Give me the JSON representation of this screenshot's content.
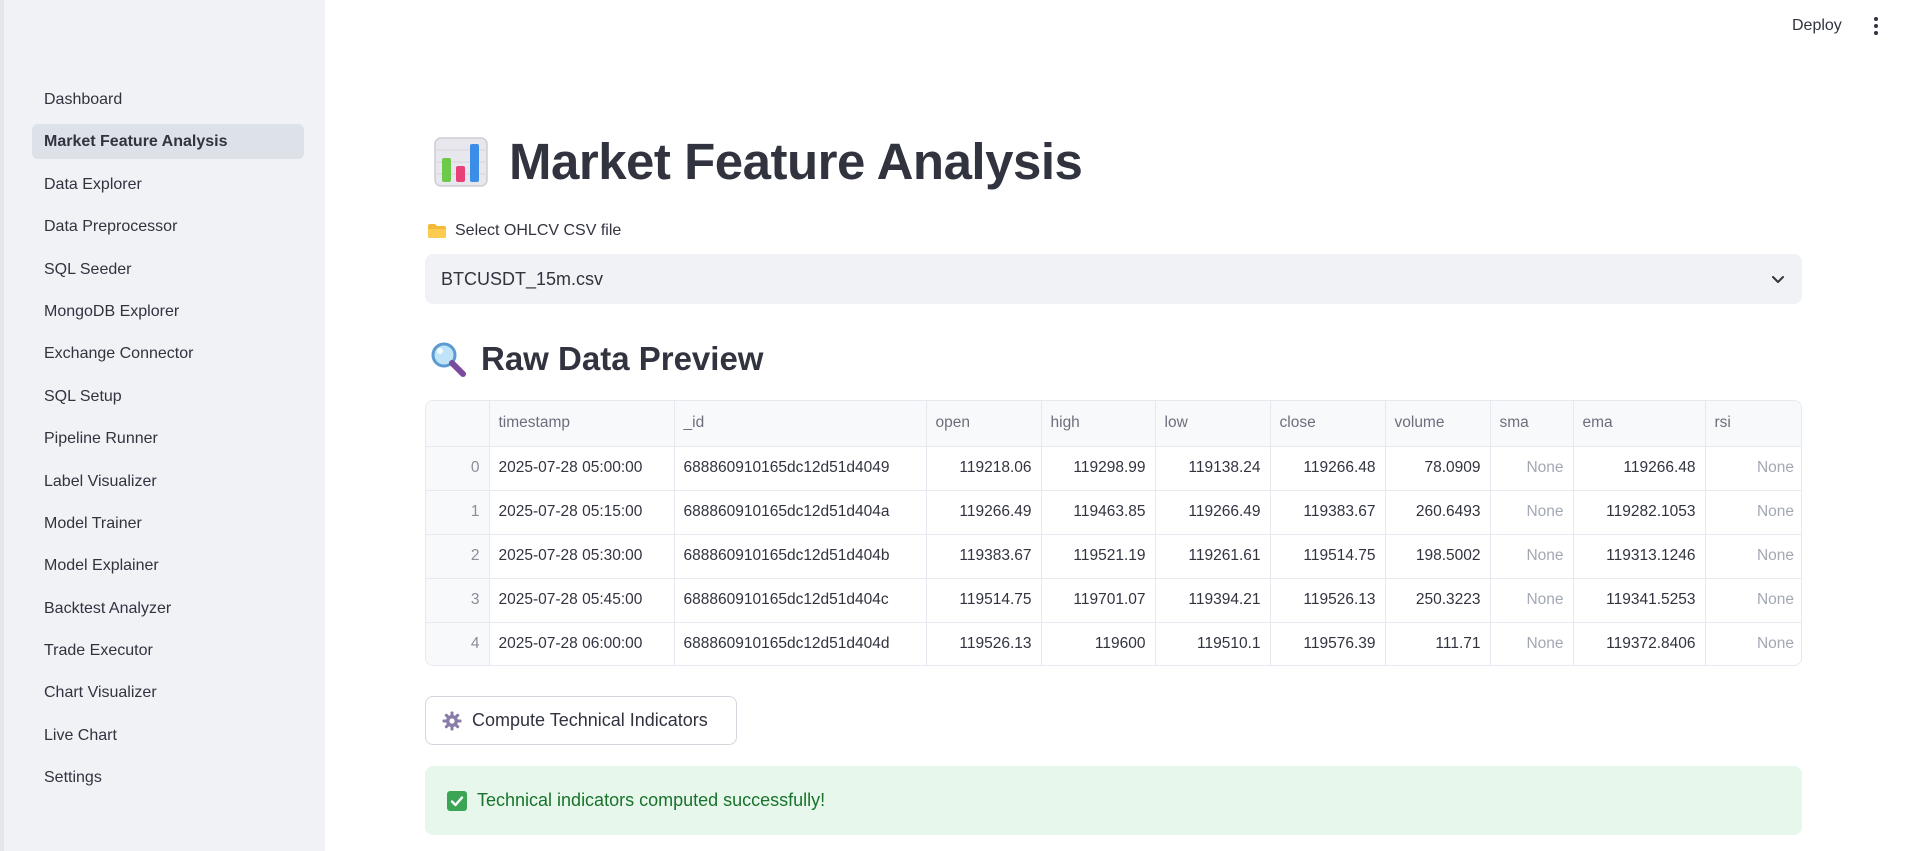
{
  "header": {
    "deploy_label": "Deploy"
  },
  "sidebar": {
    "items": [
      {
        "label": "Dashboard"
      },
      {
        "label": "Market Feature Analysis"
      },
      {
        "label": "Data Explorer"
      },
      {
        "label": "Data Preprocessor"
      },
      {
        "label": "SQL Seeder"
      },
      {
        "label": "MongoDB Explorer"
      },
      {
        "label": "Exchange Connector"
      },
      {
        "label": "SQL Setup"
      },
      {
        "label": "Pipeline Runner"
      },
      {
        "label": "Label Visualizer"
      },
      {
        "label": "Model Trainer"
      },
      {
        "label": "Model Explainer"
      },
      {
        "label": "Backtest Analyzer"
      },
      {
        "label": "Trade Executor"
      },
      {
        "label": "Chart Visualizer"
      },
      {
        "label": "Live Chart"
      },
      {
        "label": "Settings"
      }
    ],
    "active": "Market Feature Analysis"
  },
  "main": {
    "title": "Market Feature Analysis",
    "select_label": "Select OHLCV CSV file",
    "select_value": "BTCUSDT_15m.csv",
    "section_title": "Raw Data Preview",
    "table": {
      "columns": [
        "",
        "timestamp",
        "_id",
        "open",
        "high",
        "low",
        "close",
        "volume",
        "sma",
        "ema",
        "rsi"
      ],
      "rows": [
        [
          "0",
          "2025-07-28 05:00:00",
          "688860910165dc12d51d4049",
          "119218.06",
          "119298.99",
          "119138.24",
          "119266.48",
          "78.0909",
          "None",
          "119266.48",
          "None"
        ],
        [
          "1",
          "2025-07-28 05:15:00",
          "688860910165dc12d51d404a",
          "119266.49",
          "119463.85",
          "119266.49",
          "119383.67",
          "260.6493",
          "None",
          "119282.1053",
          "None"
        ],
        [
          "2",
          "2025-07-28 05:30:00",
          "688860910165dc12d51d404b",
          "119383.67",
          "119521.19",
          "119261.61",
          "119514.75",
          "198.5002",
          "None",
          "119313.1246",
          "None"
        ],
        [
          "3",
          "2025-07-28 05:45:00",
          "688860910165dc12d51d404c",
          "119514.75",
          "119701.07",
          "119394.21",
          "119526.13",
          "250.3223",
          "None",
          "119341.5253",
          "None"
        ],
        [
          "4",
          "2025-07-28 06:00:00",
          "688860910165dc12d51d404d",
          "119526.13",
          "119600",
          "119510.1",
          "119576.39",
          "111.71",
          "None",
          "119372.8406",
          "None"
        ]
      ]
    },
    "compute_button_label": "Compute Technical Indicators",
    "success_message": "Technical indicators computed successfully!"
  },
  "colors": {
    "sidebar_bg": "#f0f2f6",
    "active_item_bg": "#dde1e8",
    "success_bg": "#e8f7ec",
    "success_text": "#17732b"
  }
}
